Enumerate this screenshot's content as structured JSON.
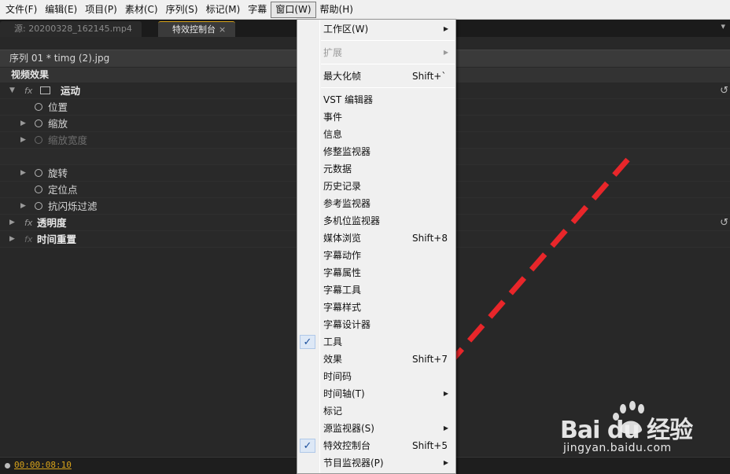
{
  "menubar": {
    "items": [
      "文件(F)",
      "编辑(E)",
      "项目(P)",
      "素材(C)",
      "序列(S)",
      "标记(M)",
      "字幕",
      "窗口(W)",
      "帮助(H)"
    ],
    "active_index": 7
  },
  "tabs": [
    {
      "label": "源: 20200328_162145.mp4",
      "active": false
    },
    {
      "label": "特效控制台",
      "active": true,
      "close": "×"
    }
  ],
  "tab_menu_glyph": "▾",
  "sequence_label": "序列 01 * timg (2).jpg",
  "section_title": "视频效果",
  "effects": [
    {
      "label": "运动",
      "indent": 0,
      "expanded": true,
      "fx": true,
      "bold": true,
      "dim": false,
      "reset": true
    },
    {
      "label": "位置",
      "indent": 1,
      "dim": false
    },
    {
      "label": "缩放",
      "indent": 1,
      "twirl": true,
      "dim": false
    },
    {
      "label": "缩放宽度",
      "indent": 1,
      "twirl": true,
      "dim": true
    },
    {
      "label": "",
      "blank": true
    },
    {
      "label": "旋转",
      "indent": 1,
      "twirl": true,
      "dim": false
    },
    {
      "label": "定位点",
      "indent": 1,
      "dim": false
    },
    {
      "label": "抗闪烁过滤",
      "indent": 1,
      "twirl": true,
      "dim": false
    },
    {
      "label": "透明度",
      "indent": 0,
      "fx": true,
      "bold": true,
      "dim": false,
      "reset": true
    },
    {
      "label": "时间重置",
      "indent": 0,
      "fx": true,
      "fx_dim": true,
      "bold": true,
      "dim": false
    }
  ],
  "timecode": "00:00:08:10",
  "window_menu": {
    "items": [
      {
        "label": "工作区(W)",
        "submenu": true
      },
      {
        "label": "扩展",
        "submenu": true,
        "disabled": true
      },
      {
        "label": "最大化帧",
        "shortcut": "Shift+`"
      },
      {
        "label": "VST 编辑器"
      },
      {
        "label": "事件"
      },
      {
        "label": "信息"
      },
      {
        "label": "修整监视器"
      },
      {
        "label": "元数据"
      },
      {
        "label": "历史记录"
      },
      {
        "label": "参考监视器"
      },
      {
        "label": "多机位监视器"
      },
      {
        "label": "媒体浏览",
        "shortcut": "Shift+8"
      },
      {
        "label": "字幕动作"
      },
      {
        "label": "字幕属性"
      },
      {
        "label": "字幕工具"
      },
      {
        "label": "字幕样式"
      },
      {
        "label": "字幕设计器"
      },
      {
        "label": "工具",
        "checked": true
      },
      {
        "label": "效果",
        "shortcut": "Shift+7"
      },
      {
        "label": "时间码"
      },
      {
        "label": "时间轴(T)",
        "submenu": true
      },
      {
        "label": "标记"
      },
      {
        "label": "源监视器(S)",
        "submenu": true
      },
      {
        "label": "特效控制台",
        "shortcut": "Shift+5",
        "checked": true
      },
      {
        "label": "节目监视器(P)",
        "submenu": true
      }
    ],
    "check_glyph": "✓",
    "arrow_glyph": "▶"
  },
  "annotation": {
    "color": "#e8262a"
  },
  "watermark": {
    "main": "Bai du 经验",
    "sub": "jingyan.baidu.com"
  }
}
